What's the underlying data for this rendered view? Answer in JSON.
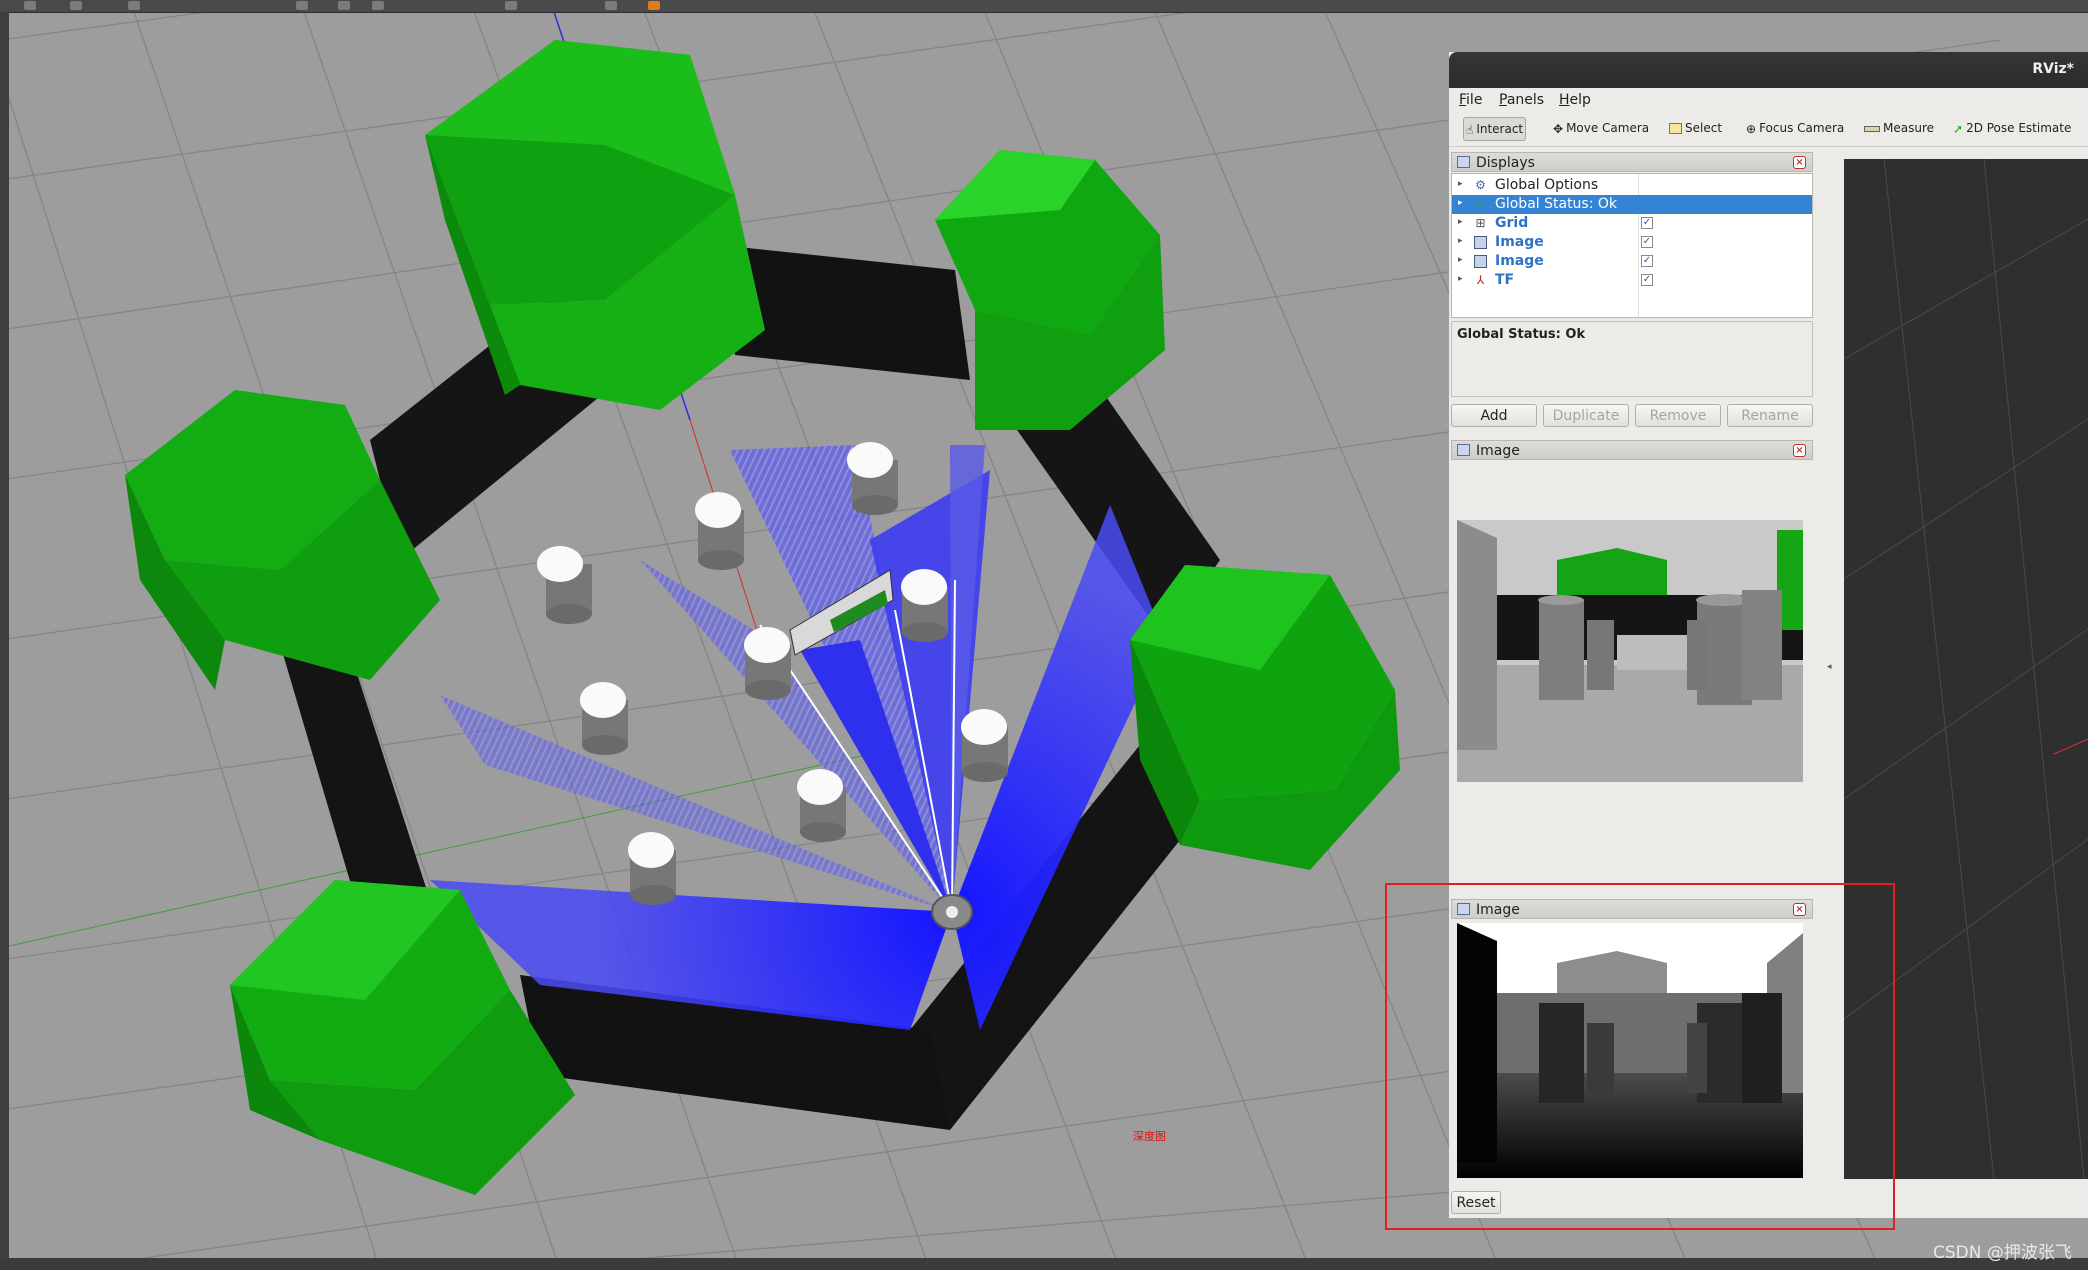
{
  "window": {
    "title": "RViz*"
  },
  "menu": [
    "File",
    "Panels",
    "Help"
  ],
  "toolbar": {
    "interact": "Interact",
    "move_camera": "Move Camera",
    "select": "Select",
    "focus_camera": "Focus Camera",
    "measure": "Measure",
    "pose_estimate": "2D Pose Estimate"
  },
  "displays": {
    "title": "Displays",
    "items": [
      {
        "label": "Global Options",
        "icon": "gear-icon",
        "checked": null
      },
      {
        "label": "Global Status: Ok",
        "icon": "check-icon",
        "checked": null,
        "selected": true
      },
      {
        "label": "Grid",
        "icon": "grid-icon",
        "checked": true
      },
      {
        "label": "Image",
        "icon": "image-icon",
        "checked": true
      },
      {
        "label": "Image",
        "icon": "image-icon",
        "checked": true
      },
      {
        "label": "TF",
        "icon": "tf-icon",
        "checked": true
      }
    ],
    "status_text": "Global Status: Ok",
    "buttons": {
      "add": "Add",
      "duplicate": "Duplicate",
      "remove": "Remove",
      "rename": "Rename"
    }
  },
  "image_panel_1": {
    "title": "Image"
  },
  "image_panel_2": {
    "title": "Image",
    "reset": "Reset"
  },
  "scene": {
    "annotation": "深度图"
  },
  "watermark": "CSDN @押波张飞",
  "colors": {
    "accent_selection": "#3584d4",
    "obstacle_green": "#1aa51a",
    "wall_black": "#111111",
    "laser_blue": "#3a3af0",
    "annotation_red": "#e02020"
  }
}
